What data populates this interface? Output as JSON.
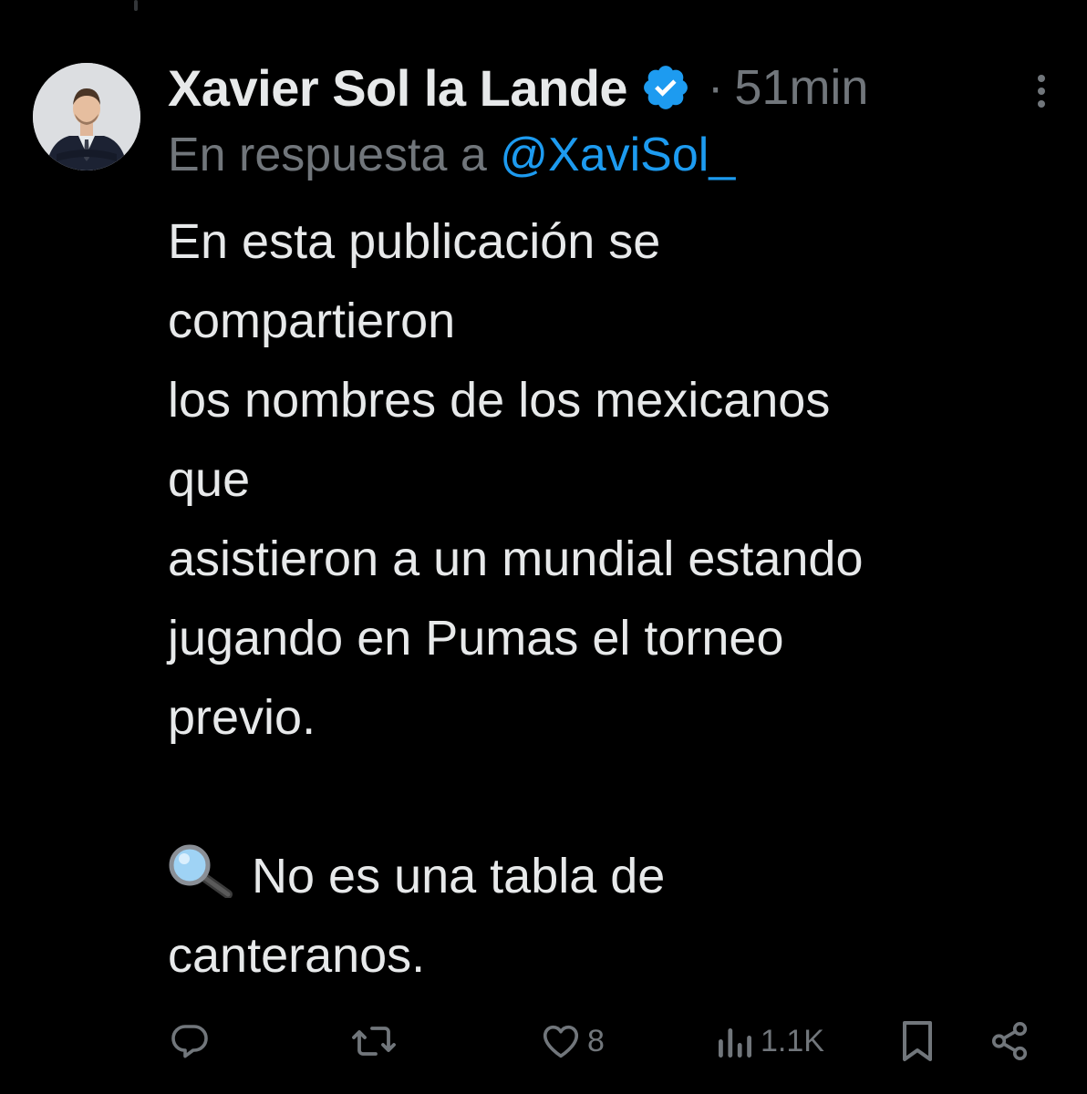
{
  "tweet": {
    "author": {
      "display_name": "Xavier Sol la Lande",
      "verified": true,
      "avatar": "person-photo"
    },
    "separator": "·",
    "time": "51min",
    "reply_to": {
      "prefix": "En respuesta a",
      "handle": "@XaviSol_"
    },
    "text_lines": [
      "En esta publicación se",
      "compartieron",
      "los nombres de los mexicanos",
      "que",
      "asistieron a un mundial estando",
      "jugando en Pumas el torneo",
      "previo.",
      "",
      "No es una tabla de",
      "canteranos."
    ],
    "emoji": "magnifying-glass-icon",
    "actions": {
      "reply": {
        "icon": "reply-icon",
        "count": ""
      },
      "retweet": {
        "icon": "retweet-icon",
        "count": ""
      },
      "like": {
        "icon": "heart-icon",
        "count": "8"
      },
      "views": {
        "icon": "views-icon",
        "count": "1.1K"
      },
      "bookmark": {
        "icon": "bookmark-icon"
      },
      "share": {
        "icon": "share-icon"
      }
    }
  },
  "colors": {
    "background": "#000000",
    "text_primary": "#e7e9ea",
    "text_secondary": "#71767b",
    "accent": "#1d9bf0"
  }
}
